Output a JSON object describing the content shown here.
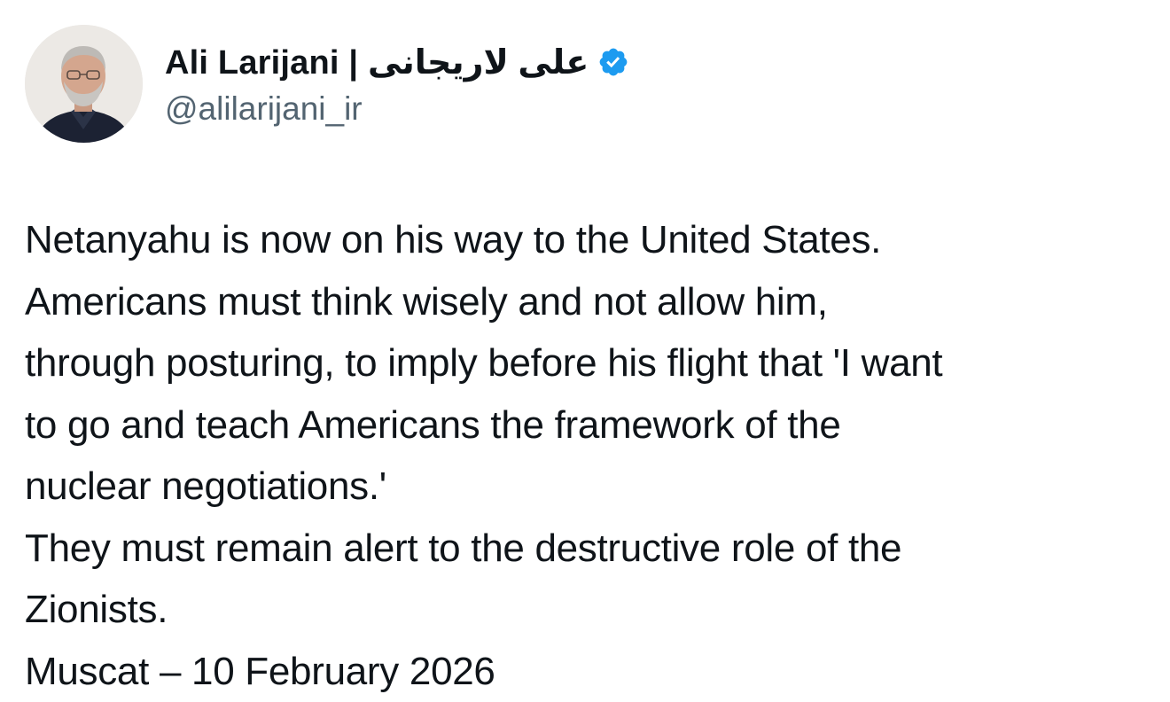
{
  "author": {
    "display_name": "Ali Larijani | علی لاریجانی",
    "handle": "@alilarijani_ir",
    "verified": true,
    "avatar_icon": "profile-photo",
    "verified_icon": "verified-badge-icon",
    "verified_color": "#1d9bf0"
  },
  "tweet": {
    "lines": [
      "Netanyahu is now on his way to the United States.",
      "Americans must think wisely and not allow him,",
      "through posturing, to imply before his flight that 'I want",
      "to go and teach Americans the framework of the",
      "nuclear negotiations.'",
      "They must remain alert to the destructive role of the",
      "Zionists.",
      "Muscat – 10 February 2026"
    ]
  },
  "colors": {
    "text": "#0f1419",
    "secondary_text": "#536471",
    "background": "#ffffff"
  }
}
